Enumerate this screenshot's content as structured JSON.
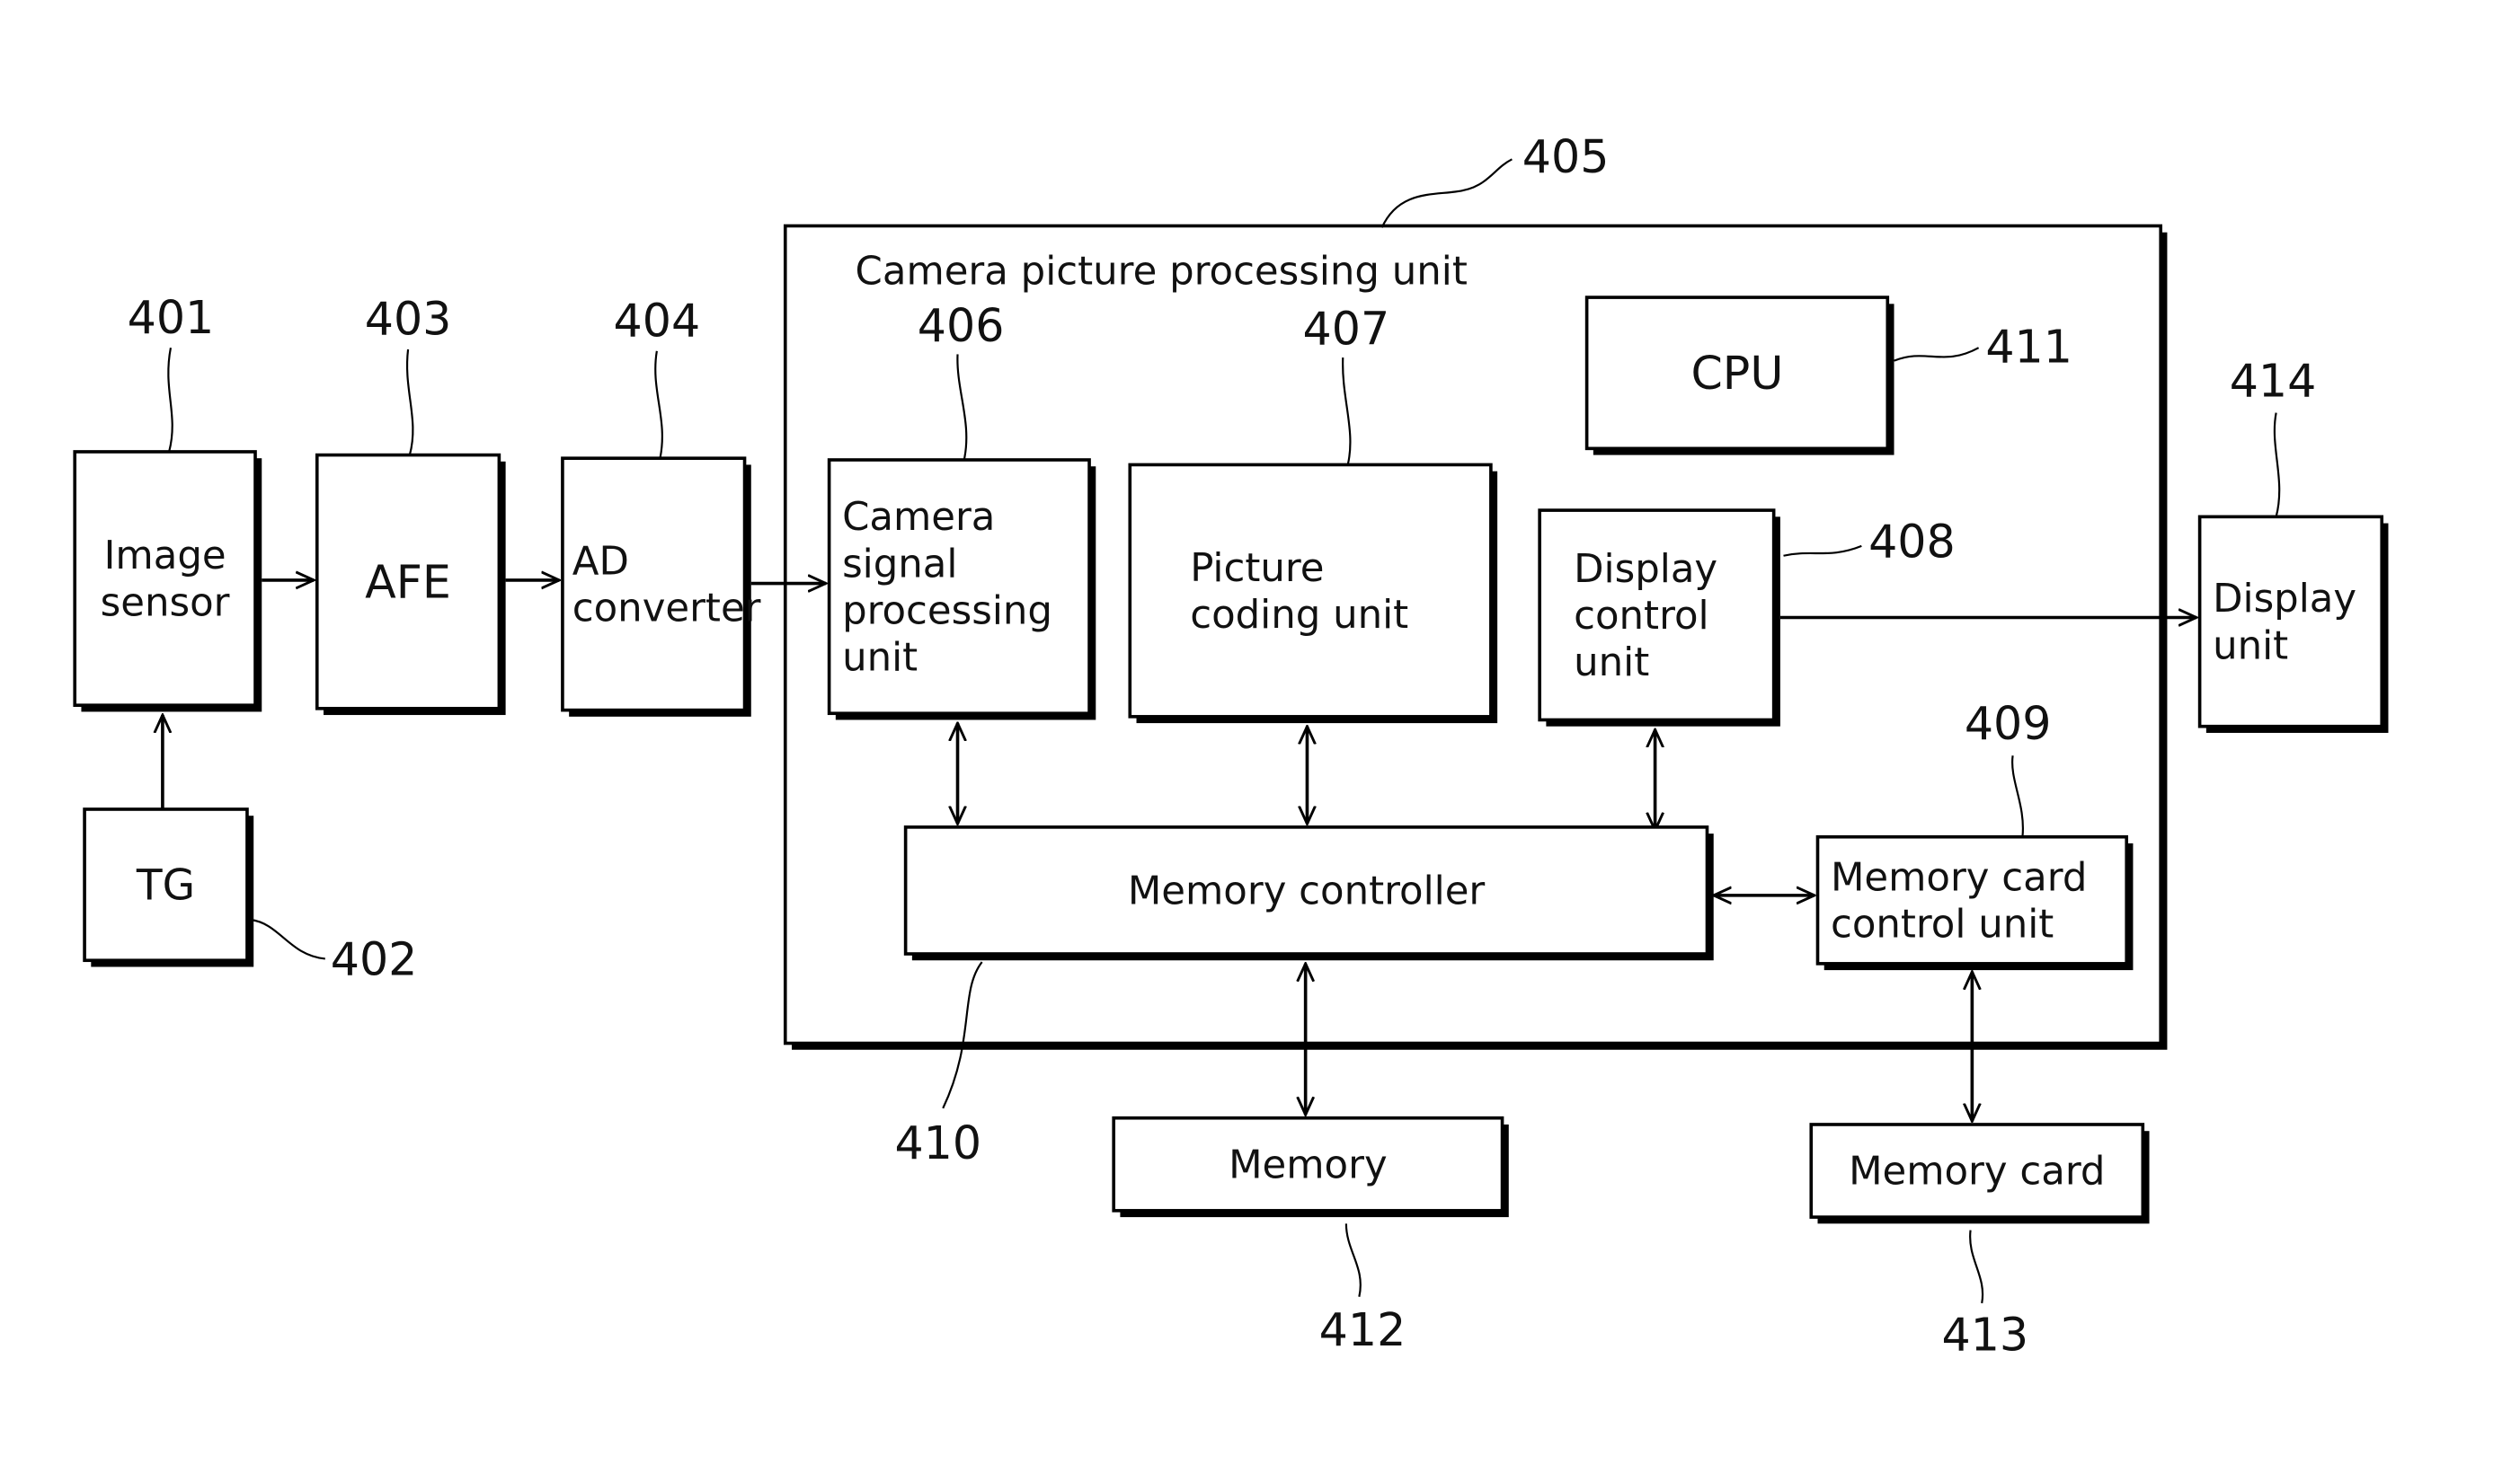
{
  "diagram": {
    "container": {
      "ref": "405",
      "title": "Camera picture processing unit"
    },
    "blocks": [
      {
        "id": "image-sensor",
        "ref": "401",
        "lines": [
          "Image",
          "sensor"
        ]
      },
      {
        "id": "tg",
        "ref": "402",
        "lines": [
          "TG"
        ]
      },
      {
        "id": "afe",
        "ref": "403",
        "lines": [
          "AFE"
        ]
      },
      {
        "id": "ad-converter",
        "ref": "404",
        "lines": [
          "AD",
          "converter"
        ]
      },
      {
        "id": "camera-signal-processing-unit",
        "ref": "406",
        "lines": [
          "Camera",
          "signal",
          "processing",
          "unit"
        ]
      },
      {
        "id": "picture-coding-unit",
        "ref": "407",
        "lines": [
          "Picture",
          "coding unit"
        ]
      },
      {
        "id": "display-control-unit",
        "ref": "408",
        "lines": [
          "Display",
          "control",
          "unit"
        ]
      },
      {
        "id": "memory-card-control-unit",
        "ref": "409",
        "lines": [
          "Memory card",
          "control unit"
        ]
      },
      {
        "id": "memory-controller",
        "ref": "410",
        "lines": [
          "Memory controller"
        ]
      },
      {
        "id": "cpu",
        "ref": "411",
        "lines": [
          "CPU"
        ]
      },
      {
        "id": "memory",
        "ref": "412",
        "lines": [
          "Memory"
        ]
      },
      {
        "id": "memory-card",
        "ref": "413",
        "lines": [
          "Memory card"
        ]
      },
      {
        "id": "display-unit",
        "ref": "414",
        "lines": [
          "Display",
          "unit"
        ]
      }
    ],
    "connections": [
      {
        "from": "tg",
        "to": "image-sensor",
        "type": "one-way"
      },
      {
        "from": "image-sensor",
        "to": "afe",
        "type": "one-way"
      },
      {
        "from": "afe",
        "to": "ad-converter",
        "type": "one-way"
      },
      {
        "from": "ad-converter",
        "to": "camera-signal-processing-unit",
        "type": "one-way"
      },
      {
        "from": "display-control-unit",
        "to": "display-unit",
        "type": "one-way"
      },
      {
        "from": "camera-signal-processing-unit",
        "to": "memory-controller",
        "type": "two-way"
      },
      {
        "from": "picture-coding-unit",
        "to": "memory-controller",
        "type": "two-way"
      },
      {
        "from": "display-control-unit",
        "to": "memory-controller",
        "type": "two-way"
      },
      {
        "from": "memory-controller",
        "to": "memory-card-control-unit",
        "type": "two-way"
      },
      {
        "from": "memory-controller",
        "to": "memory",
        "type": "two-way"
      },
      {
        "from": "memory-card-control-unit",
        "to": "memory-card",
        "type": "two-way"
      }
    ]
  }
}
